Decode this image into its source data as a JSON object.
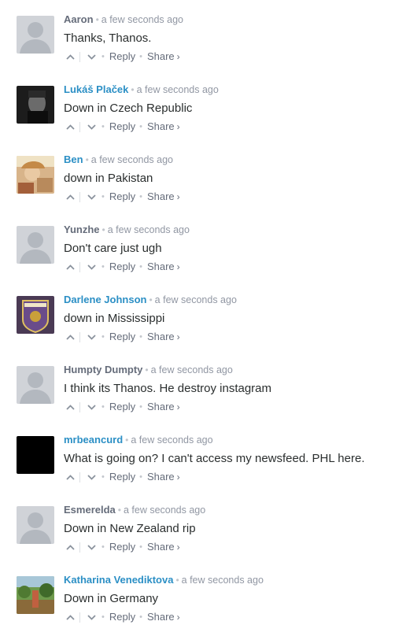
{
  "actions": {
    "reply_label": "Reply",
    "share_label": "Share",
    "share_chevron": "›",
    "upvote_icon": "chevron-up-icon",
    "downvote_icon": "chevron-down-icon"
  },
  "colors": {
    "author_plain": "#656c7a",
    "author_linked": "#2b8fc5",
    "text": "#2a2e2e",
    "time": "#9197a3"
  },
  "comments": [
    {
      "author": "Aaron",
      "linked": false,
      "time": "a few seconds ago",
      "text": "Thanks, Thanos.",
      "avatar": "default-avatar"
    },
    {
      "author": "Lukáš Plaček",
      "linked": true,
      "time": "a few seconds ago",
      "text": "Down in Czech Republic",
      "avatar": "photo-portrait-dark"
    },
    {
      "author": "Ben",
      "linked": true,
      "time": "a few seconds ago",
      "text": "down in Pakistan",
      "avatar": "photo-portrait-warm"
    },
    {
      "author": "Yunzhe",
      "linked": false,
      "time": "a few seconds ago",
      "text": "Don't care just ugh",
      "avatar": "default-avatar"
    },
    {
      "author": "Darlene Johnson",
      "linked": true,
      "time": "a few seconds ago",
      "text": "down in Mississippi",
      "avatar": "badge-emblem"
    },
    {
      "author": "Humpty Dumpty",
      "linked": false,
      "time": "a few seconds ago",
      "text": "I think its Thanos. He destroy instagram",
      "avatar": "default-avatar"
    },
    {
      "author": "mrbeancurd",
      "linked": true,
      "time": "a few seconds ago",
      "text": "What is going on? I can't access my newsfeed. PHL here.",
      "avatar": "black-square"
    },
    {
      "author": "Esmerelda",
      "linked": false,
      "time": "a few seconds ago",
      "text": "Down in New Zealand rip",
      "avatar": "default-avatar"
    },
    {
      "author": "Katharina Venediktova",
      "linked": true,
      "time": "a few seconds ago",
      "text": "Down in Germany",
      "avatar": "photo-landscape"
    }
  ]
}
